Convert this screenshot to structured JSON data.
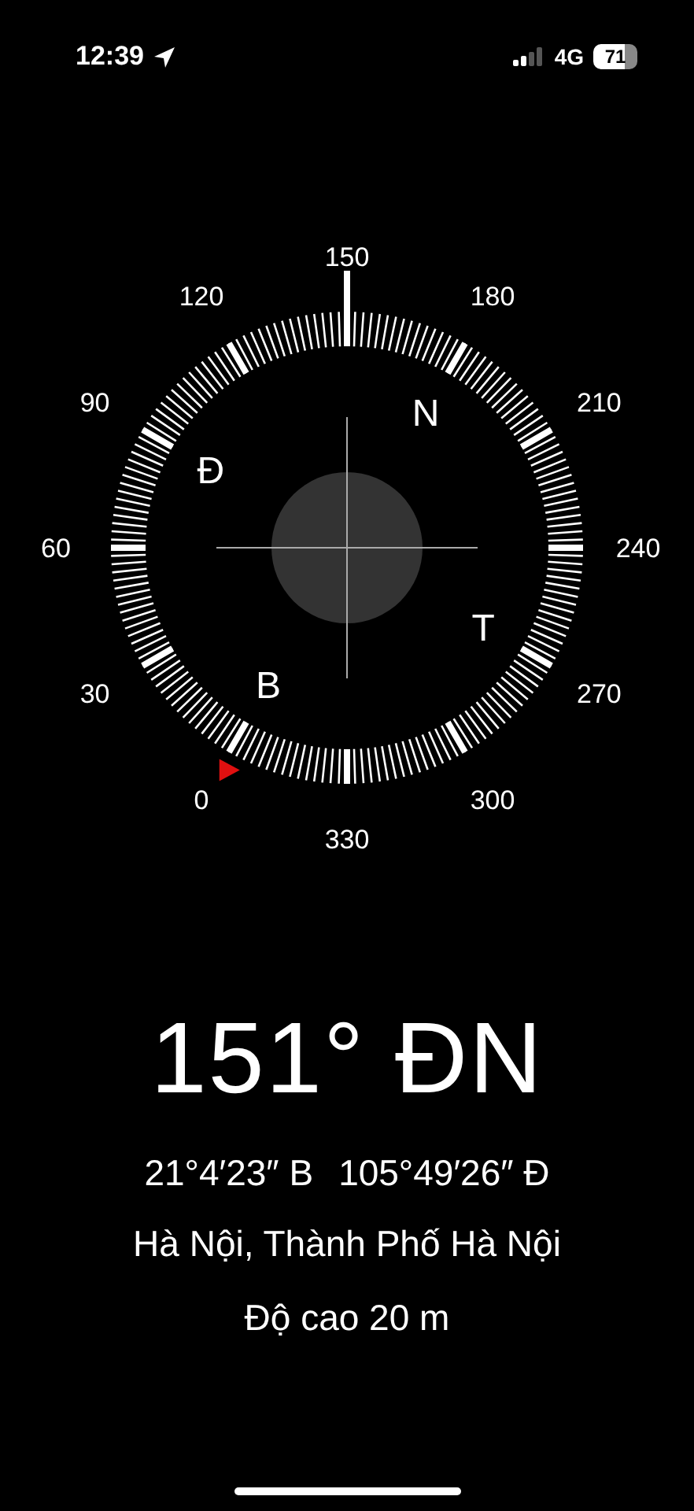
{
  "status_bar": {
    "time": "12:39",
    "network": "4G",
    "battery": "71"
  },
  "compass": {
    "degree_labels": [
      "0",
      "30",
      "60",
      "90",
      "120",
      "150",
      "180",
      "210",
      "240",
      "270",
      "300",
      "330"
    ],
    "cardinals": [
      "B",
      "Đ",
      "N",
      "T"
    ]
  },
  "heading": "151° ĐN",
  "coordinates": {
    "latitude": "21°4′23″ B",
    "longitude": "105°49′26″ Đ"
  },
  "place": "Hà Nội, Thành Phố Hà Nội",
  "altitude": "Độ cao 20 m"
}
